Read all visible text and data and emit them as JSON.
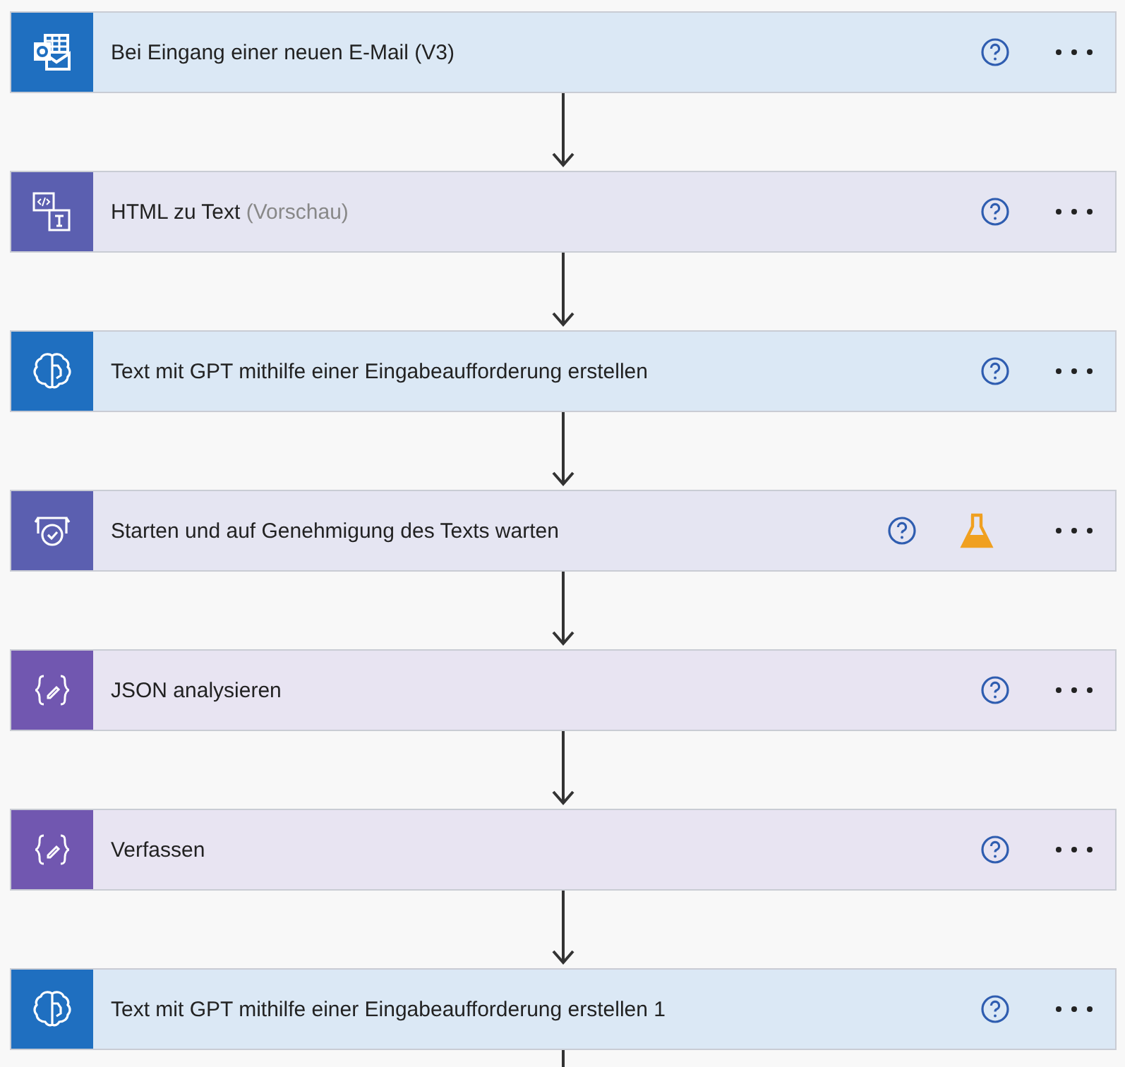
{
  "steps": [
    {
      "kind": "outlook",
      "color": "#1f6fc0",
      "title": "Bei Eingang einer neuen E-Mail (V3)",
      "testing": false
    },
    {
      "kind": "html",
      "color": "#5b5fb0",
      "title": "HTML zu Text",
      "suffix": "(Vorschau)",
      "testing": false
    },
    {
      "kind": "gpt",
      "color": "#1f6fc0",
      "title": "Text mit GPT mithilfe einer Eingabeaufforderung erstellen",
      "testing": false
    },
    {
      "kind": "approval",
      "color": "#5b5fb0",
      "title": "Starten und auf Genehmigung des Texts warten",
      "testing": true
    },
    {
      "kind": "json",
      "color": "#7157b0",
      "title": "JSON analysieren",
      "testing": false
    },
    {
      "kind": "json",
      "color": "#7157b0",
      "title": "Verfassen",
      "testing": false
    },
    {
      "kind": "gpt",
      "color": "#1f6fc0",
      "title": "Text mit GPT mithilfe einer Eingabeaufforderung erstellen 1",
      "testing": false
    }
  ]
}
